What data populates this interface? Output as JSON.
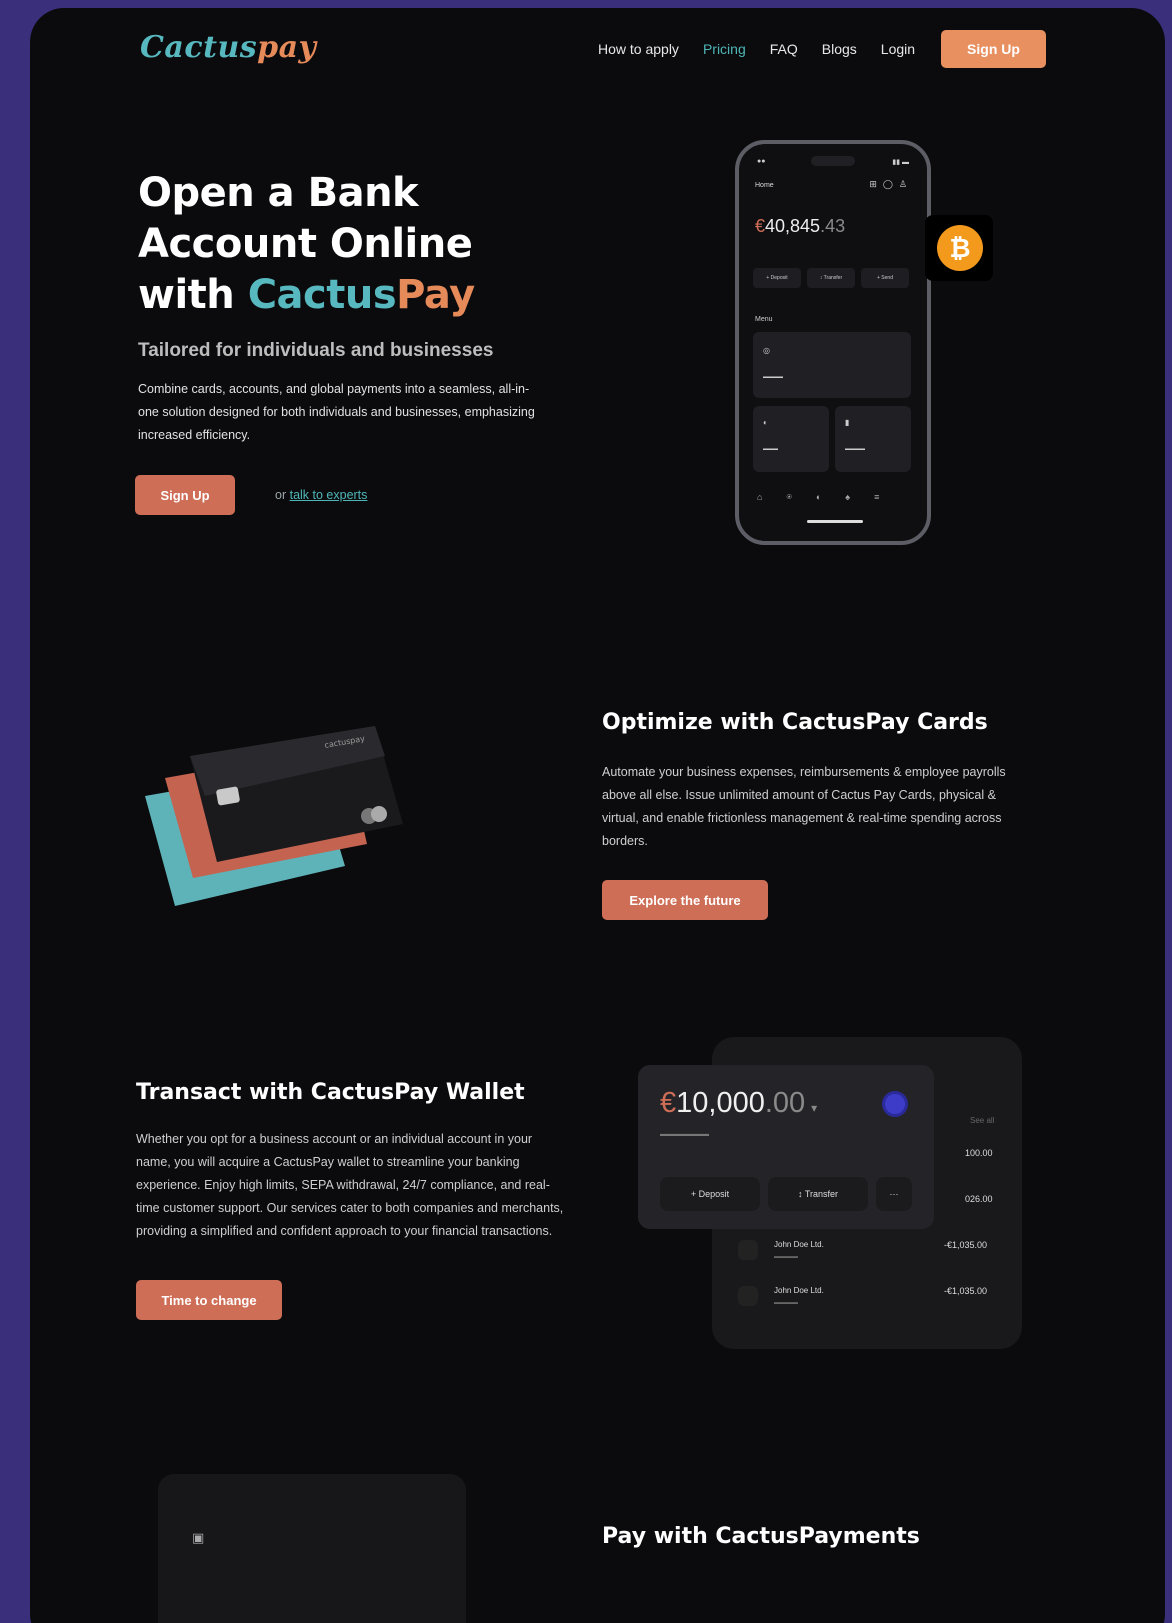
{
  "nav": {
    "logo_part1": "Cactus",
    "logo_part2": "pay",
    "items": [
      "How to apply",
      "Pricing",
      "FAQ",
      "Blogs",
      "Login"
    ],
    "signup": "Sign Up"
  },
  "hero": {
    "title_line1": "Open a Bank",
    "title_line2": "Account Online",
    "title_line3_prefix": "with ",
    "title_brand1": "Cactus",
    "title_brand2": "Pay",
    "subtitle": "Tailored for individuals and businesses",
    "description": "Combine cards, accounts, and global payments into a seamless, all-in-one solution designed for both individuals and businesses, emphasizing increased efficiency.",
    "cta": "Sign Up",
    "alt_prefix": "or ",
    "alt_link": "talk to experts"
  },
  "phone": {
    "home_label": "Home",
    "balance_currency": "€",
    "balance_int": "40,845",
    "balance_dec": ".43",
    "buttons": [
      "+ Deposit",
      "↕ Transfer",
      "+ Send"
    ],
    "menu_label": "Menu"
  },
  "cards_section": {
    "title": "Optimize with CactusPay Cards",
    "description": "Automate your business expenses, reimbursements & employee payrolls above all else. Issue unlimited amount of Cactus Pay Cards, physical & virtual, and enable frictionless management & real-time spending across borders.",
    "cta": "Explore the future"
  },
  "wallet_section": {
    "title": "Transact with CactusPay Wallet",
    "description": "Whether you opt for a business account or an individual account in your name, you will acquire a CactusPay wallet to streamline your banking experience. Enjoy high limits, SEPA withdrawal, 24/7 compliance, and real-time customer support. Our services cater to both companies and merchants, providing a simplified and confident approach to your financial transactions.",
    "cta": "Time to change",
    "widget": {
      "currency": "€",
      "balance_int": "10,000",
      "balance_dec": ".00",
      "deposit": "+ Deposit",
      "transfer": "↕ Transfer",
      "more": "···",
      "see_all": "See all",
      "amount1": "100.00",
      "amount2": "026.00",
      "rows": [
        {
          "name": "John Doe Ltd.",
          "amount": "-€1,035.00"
        },
        {
          "name": "John Doe Ltd.",
          "amount": "-€1,035.00"
        }
      ]
    }
  },
  "payments_section": {
    "title": "Pay with CactusPayments"
  },
  "colors": {
    "teal": "#57b9bf",
    "orange": "#e68a5a",
    "coral_button": "#cf6e57",
    "background": "#0b0b0d"
  }
}
